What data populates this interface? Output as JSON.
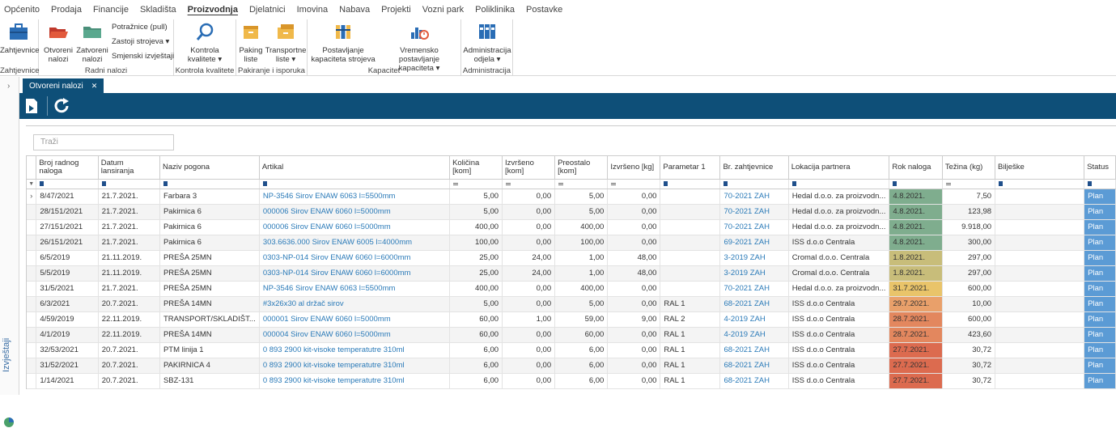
{
  "menu": [
    "Općenito",
    "Prodaja",
    "Financije",
    "Skladišta",
    "Proizvodnja",
    "Djelatnici",
    "Imovina",
    "Nabava",
    "Projekti",
    "Vozni park",
    "Poliklinika",
    "Postavke"
  ],
  "menu_active": "Proizvodnja",
  "ribbon": {
    "zahtjevnice_btn": "Zahtjevnice",
    "zahtjevnice_group": "Zahtjevnice",
    "otvoreni_btn_1": "Otvoreni",
    "otvoreni_btn_2": "nalozi",
    "zatvoreni_btn_1": "Zatvoreni",
    "zatvoreni_btn_2": "nalozi",
    "potraznice": "Potražnice (pull)",
    "zastoji": "Zastoji strojeva ▾",
    "smjenski": "Smjenski izvještaji",
    "radni_group": "Radni nalozi",
    "kontrola_btn_1": "Kontrola",
    "kontrola_btn_2": "kvalitete ▾",
    "kontrola_group": "Kontrola kvalitete",
    "paking_btn_1": "Paking",
    "paking_btn_2": "liste",
    "transportne_btn_1": "Transportne",
    "transportne_btn_2": "liste ▾",
    "pakiranje_group": "Pakiranje i isporuka",
    "postavljanje_btn_1": "Postavljanje",
    "postavljanje_btn_2": "kapaciteta strojeva",
    "vremensko_btn_1": "Vremensko postavljanje",
    "vremensko_btn_2": "kapaciteta ▾",
    "kapacitet_group": "Kapacitet",
    "administracija_btn_1": "Administracija",
    "administracija_btn_2": "odjela ▾",
    "administracija_group": "Administracija"
  },
  "left_panel": "Izvještaji",
  "tab": {
    "label": "Otvoreni nalozi",
    "close": "✕"
  },
  "search": {
    "placeholder": "Traži"
  },
  "columns": [
    "Broj radnog naloga",
    "Datum lansiranja",
    "Naziv pogona",
    "Artikal",
    "Količina [kom]",
    "Izvršeno [kom]",
    "Preostalo [kom]",
    "Izvršeno [kg]",
    "Parametar 1",
    "Br. zahtjevnice",
    "Lokacija partnera",
    "Rok naloga",
    "Težina (kg)",
    "Bilješke",
    "Status"
  ],
  "rows": [
    {
      "broj": "8/47/2021",
      "datum": "21.7.2021.",
      "pogon": "Farbara 3",
      "artikal": "NP-3546 Sirov ENAW 6063 l=5500mm",
      "kolicina": "5,00",
      "izvrseno": "0,00",
      "preostalo": "5,00",
      "izvrseno_kg": "0,00",
      "param": "",
      "zahtjevnica": "70-2021 ZAH",
      "lokacija": "Hedal d.o.o. za proizvodn...",
      "rok": "4.8.2021.",
      "rok_color": "#7fad8e",
      "tezina": "7,50",
      "biljeske": "",
      "status": "Plan"
    },
    {
      "broj": "28/151/2021",
      "datum": "21.7.2021.",
      "pogon": "Pakirnica 6",
      "artikal": "000006 Sirov ENAW 6060 l=5000mm",
      "kolicina": "5,00",
      "izvrseno": "0,00",
      "preostalo": "5,00",
      "izvrseno_kg": "0,00",
      "param": "",
      "zahtjevnica": "70-2021 ZAH",
      "lokacija": "Hedal d.o.o. za proizvodn...",
      "rok": "4.8.2021.",
      "rok_color": "#7fad8e",
      "tezina": "123,98",
      "biljeske": "",
      "status": "Plan"
    },
    {
      "broj": "27/151/2021",
      "datum": "21.7.2021.",
      "pogon": "Pakirnica 6",
      "artikal": "000006 Sirov ENAW 6060 l=5000mm",
      "kolicina": "400,00",
      "izvrseno": "0,00",
      "preostalo": "400,00",
      "izvrseno_kg": "0,00",
      "param": "",
      "zahtjevnica": "70-2021 ZAH",
      "lokacija": "Hedal d.o.o. za proizvodn...",
      "rok": "4.8.2021.",
      "rok_color": "#7fad8e",
      "tezina": "9.918,00",
      "biljeske": "",
      "status": "Plan"
    },
    {
      "broj": "26/151/2021",
      "datum": "21.7.2021.",
      "pogon": "Pakirnica 6",
      "artikal": "303.6636.000 Sirov ENAW 6005 l=4000mm",
      "kolicina": "100,00",
      "izvrseno": "0,00",
      "preostalo": "100,00",
      "izvrseno_kg": "0,00",
      "param": "",
      "zahtjevnica": "69-2021 ZAH",
      "lokacija": "ISS d.o.o Centrala",
      "rok": "4.8.2021.",
      "rok_color": "#7fad8e",
      "tezina": "300,00",
      "biljeske": "",
      "status": "Plan"
    },
    {
      "broj": "6/5/2019",
      "datum": "21.11.2019.",
      "pogon": "PREŠA 25MN",
      "artikal": "0303-NP-014 Sirov ENAW 6060 l=6000mm",
      "kolicina": "25,00",
      "izvrseno": "24,00",
      "preostalo": "1,00",
      "izvrseno_kg": "48,00",
      "param": "",
      "zahtjevnica": "3-2019 ZAH",
      "lokacija": "Cromal d.o.o. Centrala",
      "rok": "1.8.2021.",
      "rok_color": "#c8bd7a",
      "tezina": "297,00",
      "biljeske": "",
      "status": "Plan"
    },
    {
      "broj": "5/5/2019",
      "datum": "21.11.2019.",
      "pogon": "PREŠA 25MN",
      "artikal": "0303-NP-014 Sirov ENAW 6060 l=6000mm",
      "kolicina": "25,00",
      "izvrseno": "24,00",
      "preostalo": "1,00",
      "izvrseno_kg": "48,00",
      "param": "",
      "zahtjevnica": "3-2019 ZAH",
      "lokacija": "Cromal d.o.o. Centrala",
      "rok": "1.8.2021.",
      "rok_color": "#c8bd7a",
      "tezina": "297,00",
      "biljeske": "",
      "status": "Plan"
    },
    {
      "broj": "31/5/2021",
      "datum": "21.7.2021.",
      "pogon": "PREŠA 25MN",
      "artikal": "NP-3546 Sirov ENAW 6063 l=5500mm",
      "kolicina": "400,00",
      "izvrseno": "0,00",
      "preostalo": "400,00",
      "izvrseno_kg": "0,00",
      "param": "",
      "zahtjevnica": "70-2021 ZAH",
      "lokacija": "Hedal d.o.o. za proizvodn...",
      "rok": "31.7.2021.",
      "rok_color": "#e9c46a",
      "tezina": "600,00",
      "biljeske": "",
      "status": "Plan"
    },
    {
      "broj": "6/3/2021",
      "datum": "20.7.2021.",
      "pogon": "PREŠA 14MN",
      "artikal": "#3x26x30 al držač sirov",
      "kolicina": "5,00",
      "izvrseno": "0,00",
      "preostalo": "5,00",
      "izvrseno_kg": "0,00",
      "param": "RAL 1",
      "zahtjevnica": "68-2021 ZAH",
      "lokacija": "ISS d.o.o Centrala",
      "rok": "29.7.2021.",
      "rok_color": "#e9a06a",
      "tezina": "10,00",
      "biljeske": "",
      "status": "Plan"
    },
    {
      "broj": "4/59/2019",
      "datum": "22.11.2019.",
      "pogon": "TRANSPORT/SKLADIŠT...",
      "artikal": "000001 Sirov ENAW 6060 l=5000mm",
      "kolicina": "60,00",
      "izvrseno": "1,00",
      "preostalo": "59,00",
      "izvrseno_kg": "9,00",
      "param": "RAL 2",
      "zahtjevnica": "4-2019 ZAH",
      "lokacija": "ISS d.o.o Centrala",
      "rok": "28.7.2021.",
      "rok_color": "#e3875e",
      "tezina": "600,00",
      "biljeske": "",
      "status": "Plan"
    },
    {
      "broj": "4/1/2019",
      "datum": "22.11.2019.",
      "pogon": "PREŠA 14MN",
      "artikal": "000004 Sirov ENAW 6060 l=5000mm",
      "kolicina": "60,00",
      "izvrseno": "0,00",
      "preostalo": "60,00",
      "izvrseno_kg": "0,00",
      "param": "RAL 1",
      "zahtjevnica": "4-2019 ZAH",
      "lokacija": "ISS d.o.o Centrala",
      "rok": "28.7.2021.",
      "rok_color": "#e3875e",
      "tezina": "423,60",
      "biljeske": "",
      "status": "Plan"
    },
    {
      "broj": "32/53/2021",
      "datum": "20.7.2021.",
      "pogon": "PTM linija 1",
      "artikal": "0 893 2900 kit-visoke temperatutre 310ml",
      "kolicina": "6,00",
      "izvrseno": "0,00",
      "preostalo": "6,00",
      "izvrseno_kg": "0,00",
      "param": "RAL 1",
      "zahtjevnica": "68-2021 ZAH",
      "lokacija": "ISS d.o.o Centrala",
      "rok": "27.7.2021.",
      "rok_color": "#dc6b4f",
      "tezina": "30,72",
      "biljeske": "",
      "status": "Plan"
    },
    {
      "broj": "31/52/2021",
      "datum": "20.7.2021.",
      "pogon": "PAKIRNICA 4",
      "artikal": "0 893 2900 kit-visoke temperatutre 310ml",
      "kolicina": "6,00",
      "izvrseno": "0,00",
      "preostalo": "6,00",
      "izvrseno_kg": "0,00",
      "param": "RAL 1",
      "zahtjevnica": "68-2021 ZAH",
      "lokacija": "ISS d.o.o Centrala",
      "rok": "27.7.2021.",
      "rok_color": "#dc6b4f",
      "tezina": "30,72",
      "biljeske": "",
      "status": "Plan"
    },
    {
      "broj": "1/14/2021",
      "datum": "20.7.2021.",
      "pogon": "SBZ-131",
      "artikal": "0 893 2900 kit-visoke temperatutre 310ml",
      "kolicina": "6,00",
      "izvrseno": "0,00",
      "preostalo": "6,00",
      "izvrseno_kg": "0,00",
      "param": "RAL 1",
      "zahtjevnica": "68-2021 ZAH",
      "lokacija": "ISS d.o.o Centrala",
      "rok": "27.7.2021.",
      "rok_color": "#dc6b4f",
      "tezina": "30,72",
      "biljeske": "",
      "status": "Plan"
    }
  ]
}
